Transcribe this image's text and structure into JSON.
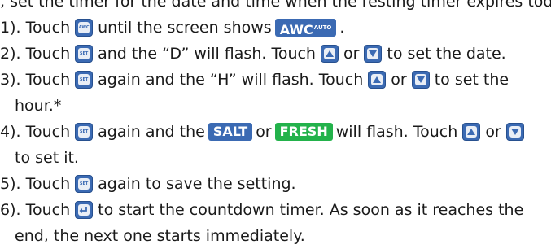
{
  "doc": {
    "line0_tail": ", set the timer for the date and time when the resting timer expires today",
    "step1": {
      "num": "1). Touch",
      "mid": "until the screen shows",
      "end": "."
    },
    "step2": {
      "num": "2). Touch",
      "mid": "and the “D” will flash. Touch",
      "or": "or",
      "end": "to set the date."
    },
    "step3": {
      "num": "3). Touch",
      "mid": "again and the “H” will flash. Touch",
      "or": "or",
      "end": "to set the",
      "cont": "hour.*"
    },
    "step4": {
      "num": "4). Touch",
      "mid": "again and the",
      "or1": "or",
      "mid2": "will flash. Touch",
      "or2": "or",
      "cont": "to set it."
    },
    "step5": {
      "num": "5). Touch",
      "end": "again to save the setting."
    },
    "step6": {
      "num": "6). Touch",
      "end": "to start the countdown timer. As soon as it reaches the",
      "cont": "end, the next one starts immediately."
    }
  },
  "badges": {
    "awc": "AWC",
    "awc_sup": "AUTO",
    "salt": "SALT",
    "fresh": "FRESH"
  },
  "keys": {
    "awc_key": "AWC",
    "set_key": "SET"
  },
  "colors": {
    "button_blue": "#3b6ab3",
    "fresh_green": "#23b24b",
    "text": "#1a1a1a"
  },
  "icons": [
    "awc-key-icon",
    "set-key-icon",
    "up-arrow-key-icon",
    "down-arrow-key-icon",
    "enter-return-key-icon"
  ]
}
